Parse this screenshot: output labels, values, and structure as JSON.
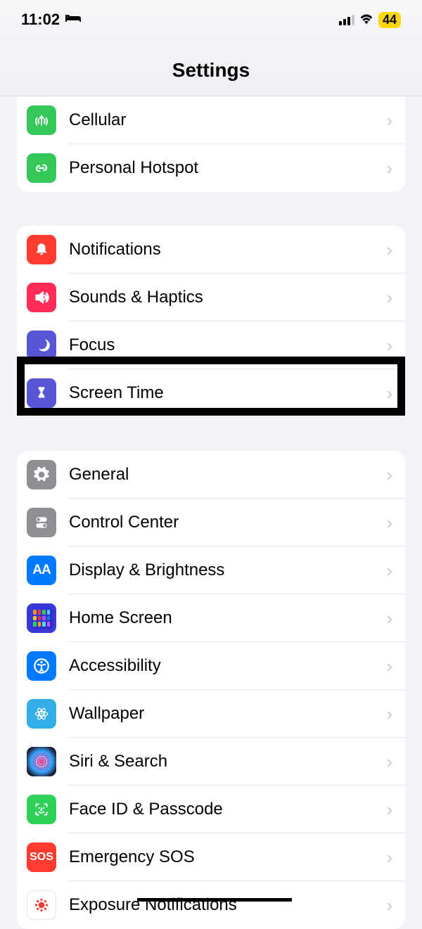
{
  "status": {
    "time": "11:02",
    "battery": "44"
  },
  "page_title": "Settings",
  "groups": [
    {
      "rows": [
        {
          "id": "cellular",
          "label": "Cellular"
        },
        {
          "id": "personal-hotspot",
          "label": "Personal Hotspot"
        }
      ]
    },
    {
      "rows": [
        {
          "id": "notifications",
          "label": "Notifications"
        },
        {
          "id": "sounds-haptics",
          "label": "Sounds & Haptics"
        },
        {
          "id": "focus",
          "label": "Focus"
        },
        {
          "id": "screen-time",
          "label": "Screen Time"
        }
      ]
    },
    {
      "rows": [
        {
          "id": "general",
          "label": "General"
        },
        {
          "id": "control-center",
          "label": "Control Center"
        },
        {
          "id": "display-brightness",
          "label": "Display & Brightness"
        },
        {
          "id": "home-screen",
          "label": "Home Screen"
        },
        {
          "id": "accessibility",
          "label": "Accessibility"
        },
        {
          "id": "wallpaper",
          "label": "Wallpaper"
        },
        {
          "id": "siri-search",
          "label": "Siri & Search"
        },
        {
          "id": "face-id-passcode",
          "label": "Face ID & Passcode"
        },
        {
          "id": "emergency-sos",
          "label": "Emergency SOS"
        },
        {
          "id": "exposure-notifications",
          "label": "Exposure Notifications"
        }
      ]
    }
  ],
  "annotations": {
    "highlighted_row": "screen-time",
    "strikethrough_row": "exposure-notifications"
  }
}
